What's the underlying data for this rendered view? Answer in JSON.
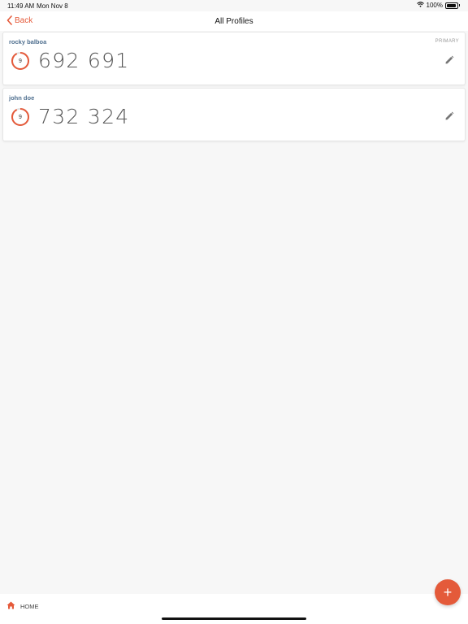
{
  "status": {
    "time": "11:49 AM",
    "date": "Mon Nov 8",
    "battery": "100%"
  },
  "nav": {
    "back_label": "Back",
    "title": "All Profiles"
  },
  "profiles": [
    {
      "name": "rocky balboa",
      "tag": "PRIMARY",
      "timer": "9",
      "code": "692 691"
    },
    {
      "name": "john doe",
      "tag": "",
      "timer": "9",
      "code": "732 324"
    }
  ],
  "bottom": {
    "home_label": "HOME"
  },
  "colors": {
    "accent": "#e55a3a",
    "name": "#4f6f8f"
  },
  "icons": {
    "back": "chevron-left-icon",
    "edit": "pencil-icon",
    "home": "house-icon",
    "add": "plus-icon",
    "wifi": "wifi-icon",
    "battery": "battery-icon"
  }
}
